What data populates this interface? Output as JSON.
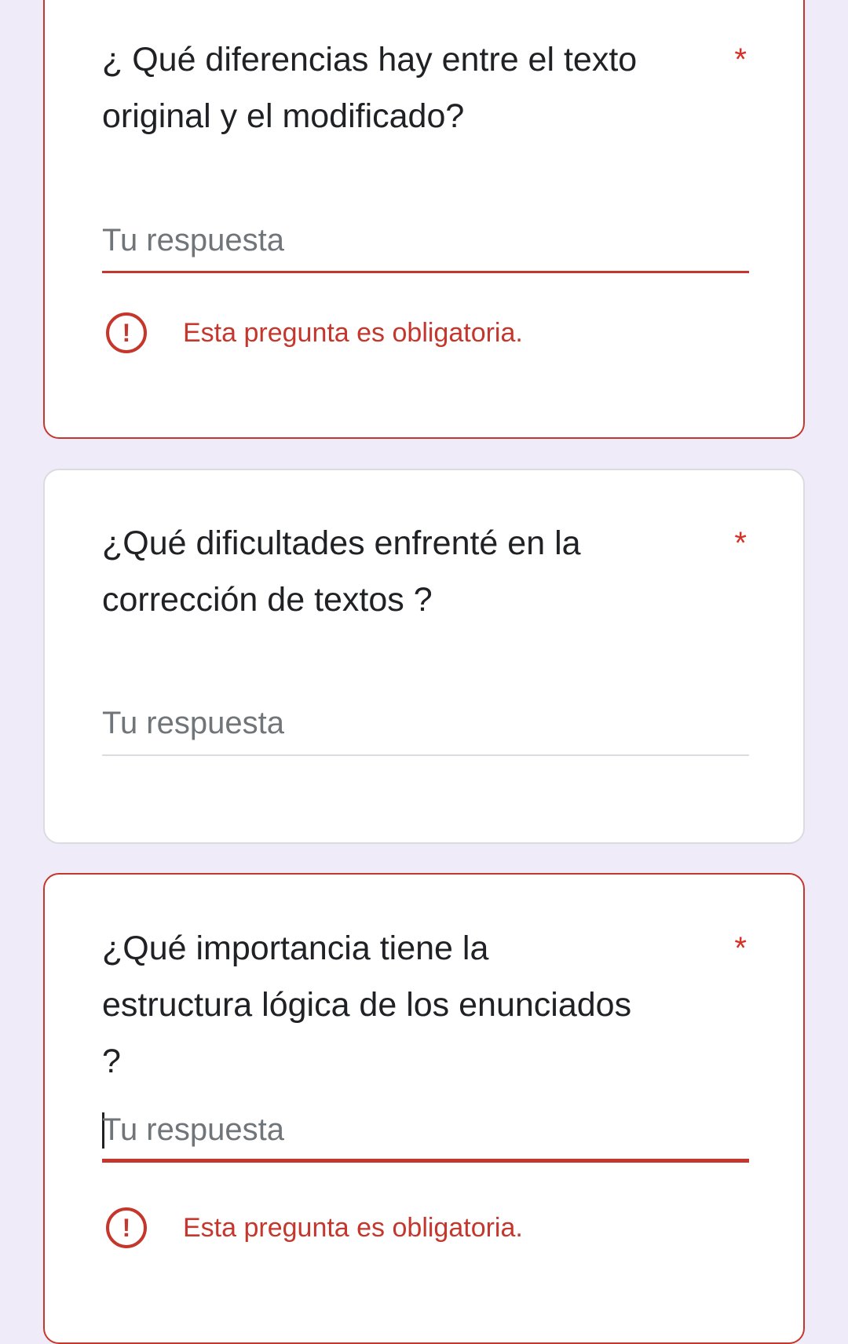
{
  "questions": [
    {
      "title": "¿ Qué diferencias hay entre el texto original y el modificado?",
      "required_mark": "*",
      "answer_placeholder": "Tu respuesta",
      "error_message": "Esta pregunta es obligatoria.",
      "state": "error"
    },
    {
      "title": "¿Qué dificultades enfrenté en la corrección de textos ?",
      "required_mark": "*",
      "answer_placeholder": "Tu respuesta",
      "state": "normal"
    },
    {
      "title": "¿Qué importancia tiene la estructura lógica de los enunciados ?",
      "required_mark": "*",
      "answer_placeholder": "Tu respuesta",
      "error_message": "Esta pregunta es obligatoria.",
      "state": "error-focused"
    }
  ],
  "icons": {
    "error_icon": "!"
  },
  "colors": {
    "background": "#f0ebf8",
    "error": "#c5372c",
    "required_star": "#d93025",
    "placeholder": "#70757a",
    "text": "#202124"
  }
}
